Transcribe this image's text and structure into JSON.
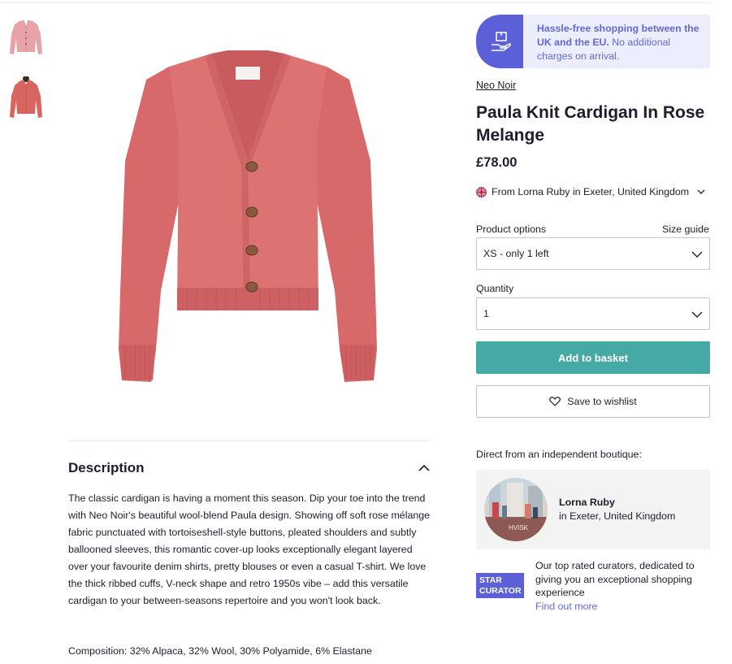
{
  "gallery": {
    "thumbnails": [
      "cardigan-front-light-pink",
      "cardigan-on-model-rose"
    ],
    "main_image": "rose-knit-cardigan-front"
  },
  "banner": {
    "bold": "Hassle-free shopping between the UK and the EU.",
    "rest": " No additional charges on arrival.",
    "icon": "hand-with-parcel-icon",
    "color": "#5b5fd8"
  },
  "product": {
    "brand": "Neo Noir",
    "title": "Paula Knit Cardigan In Rose Melange",
    "price": "£78.00",
    "seller_line": "From Lorna Ruby in Exeter, United Kingdom"
  },
  "options": {
    "product_options_label": "Product options",
    "size_guide_label": "Size guide",
    "size_value": "XS - only 1 left",
    "quantity_label": "Quantity",
    "quantity_value": "1"
  },
  "actions": {
    "add_to_basket": "Add to basket",
    "add_to_basket_color": "#46aaa4",
    "save_to_wishlist": "Save to wishlist"
  },
  "description": {
    "heading": "Description",
    "body": "The classic cardigan is having a moment this season. Dip your toe into the trend with Neo Noir's beautiful wool-blend Paula design. Showing off soft rose mélange fabric punctuated with tortoiseshell-style buttons, pleated shoulders and subtly ballooned sleeves, this romantic cover-up looks exceptionally elegant layered over your favourite denim shirts, pretty blouses or even a casual T-shirt. We love the thick ribbed cuffs, V-neck shape and retro 1950s vibe – add this versatile cardigan to your between-seasons repertoire and you won't look back.",
    "composition": "Composition: 32% Alpaca, 32% Wool, 30% Polyamide, 6% Elastane"
  },
  "boutique": {
    "intro": "Direct from an independent boutique:",
    "name": "Lorna Ruby",
    "location": "in Exeter, United Kingdom"
  },
  "curator": {
    "badge_line1": "STAR",
    "badge_line2": "CURATOR",
    "text": "Our top rated curators, dedicated to giving you an exceptional shopping experience",
    "link": "Find out more"
  }
}
